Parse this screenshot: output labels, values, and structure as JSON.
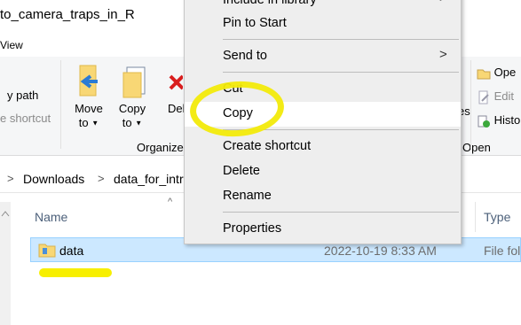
{
  "window": {
    "title": "to_camera_traps_in_R",
    "view_tab": "View"
  },
  "ribbon": {
    "copy_path": "y path",
    "paste_shortcut": "e shortcut",
    "move_to": "Move",
    "move_to_2": "to",
    "copy_to": "Copy",
    "copy_to_2": "to",
    "delete": "Del",
    "organize": "Organize",
    "es": "es",
    "open_group": "Open",
    "open_items": [
      "Ope",
      "Edit",
      "Histo"
    ]
  },
  "address": {
    "crumbs": [
      "Downloads",
      "data_for_intr"
    ]
  },
  "columns": {
    "name": "Name",
    "type": "Type"
  },
  "files": [
    {
      "name": "data",
      "date": "2022-10-19 8:33 AM",
      "type": "File fol"
    }
  ],
  "context_menu": {
    "items": [
      "Include in library",
      "Pin to Start",
      "Send to",
      "Cut",
      "Copy",
      "Create shortcut",
      "Delete",
      "Rename",
      "Properties"
    ],
    "hovered": "Copy"
  },
  "colors": {
    "highlight": "#f2ea0a",
    "selection": "#cce8ff",
    "folder": "#f8d775"
  }
}
